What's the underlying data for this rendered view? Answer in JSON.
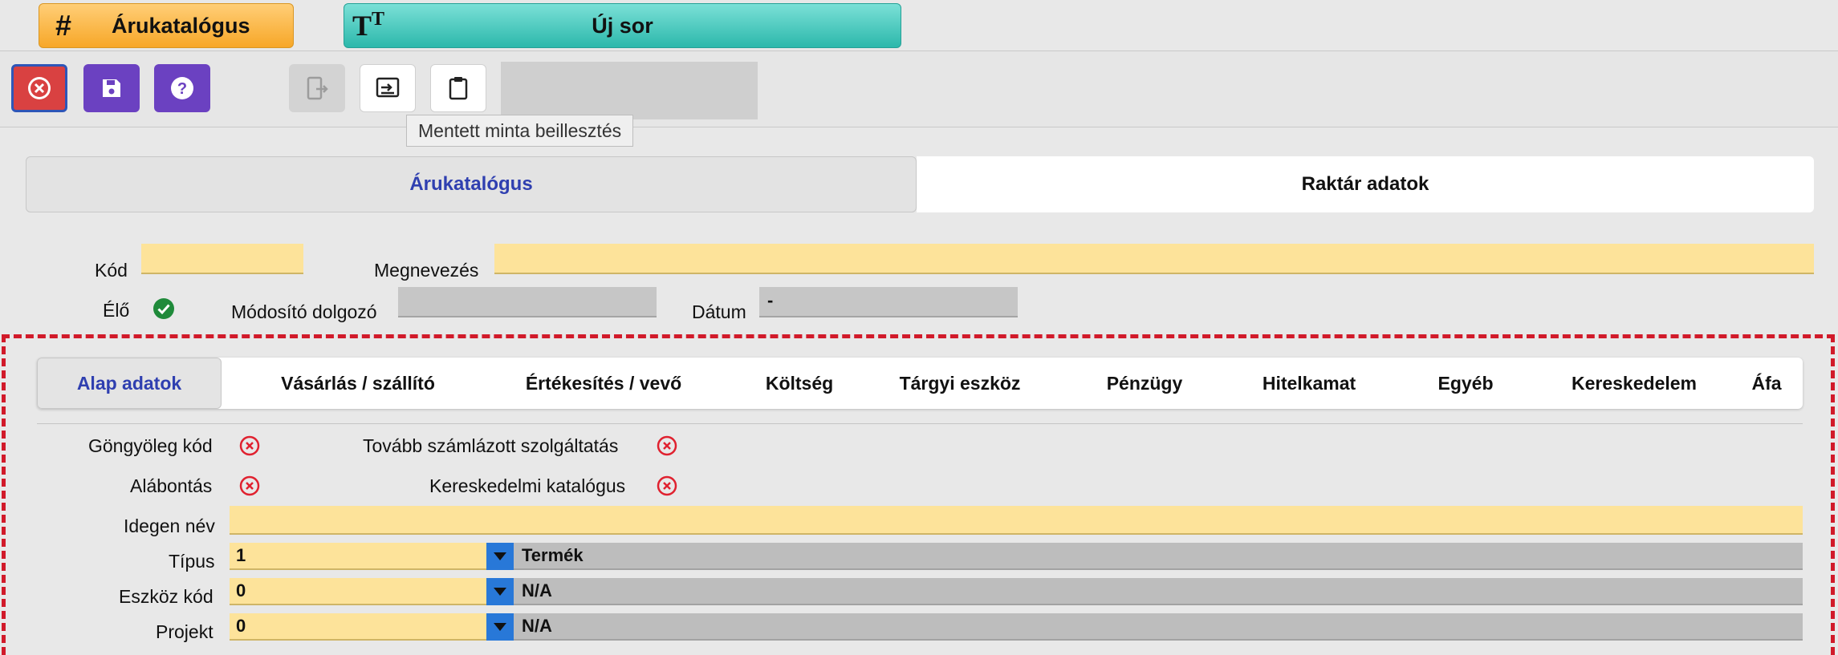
{
  "top_tabs": {
    "catalog": {
      "icon": "hash-icon",
      "label": "Árukatalógus"
    },
    "new_row": {
      "icon": "text-size-icon",
      "label": "Új sor"
    }
  },
  "toolbar": {
    "buttons": [
      "close-icon",
      "save-icon",
      "help-icon",
      "export-icon",
      "paste-sample-icon",
      "clipboard-icon"
    ],
    "tooltip": "Mentett minta beillesztés"
  },
  "section_tabs": {
    "catalog": "Árukatalógus",
    "warehouse": "Raktár adatok"
  },
  "header_fields": {
    "code_label": "Kód",
    "code_value": "",
    "name_label": "Megnevezés",
    "name_value": "",
    "alive_label": "Élő",
    "modifier_label": "Módosító dolgozó",
    "modifier_value": "",
    "date_label": "Dátum",
    "date_value": "-"
  },
  "inner_tabs": [
    "Alap adatok",
    "Vásárlás / szállító",
    "Értékesítés / vevő",
    "Költség",
    "Tárgyi eszköz",
    "Pénzügy",
    "Hitelkamat",
    "Egyéb",
    "Kereskedelem",
    "Áfa"
  ],
  "flags": {
    "packaging_code": "Göngyöleg kód",
    "rebilled_service": "Tovább számlázott szolgáltatás",
    "sub_breakdown": "Alábontás",
    "trade_catalog": "Kereskedelmi katalógus"
  },
  "fields": {
    "foreign_name_label": "Idegen név",
    "foreign_name_value": "",
    "type_label": "Típus",
    "type_code": "1",
    "type_name": "Termék",
    "asset_label": "Eszköz kód",
    "asset_code": "0",
    "asset_name": "N/A",
    "project_label": "Projekt",
    "project_code": "0",
    "project_name": "N/A"
  },
  "colors": {
    "accent_orange": "#f7a728",
    "accent_teal": "#2cb8ab",
    "purple": "#6b41c1",
    "red": "#d94141",
    "field_yellow": "#fde39a"
  }
}
